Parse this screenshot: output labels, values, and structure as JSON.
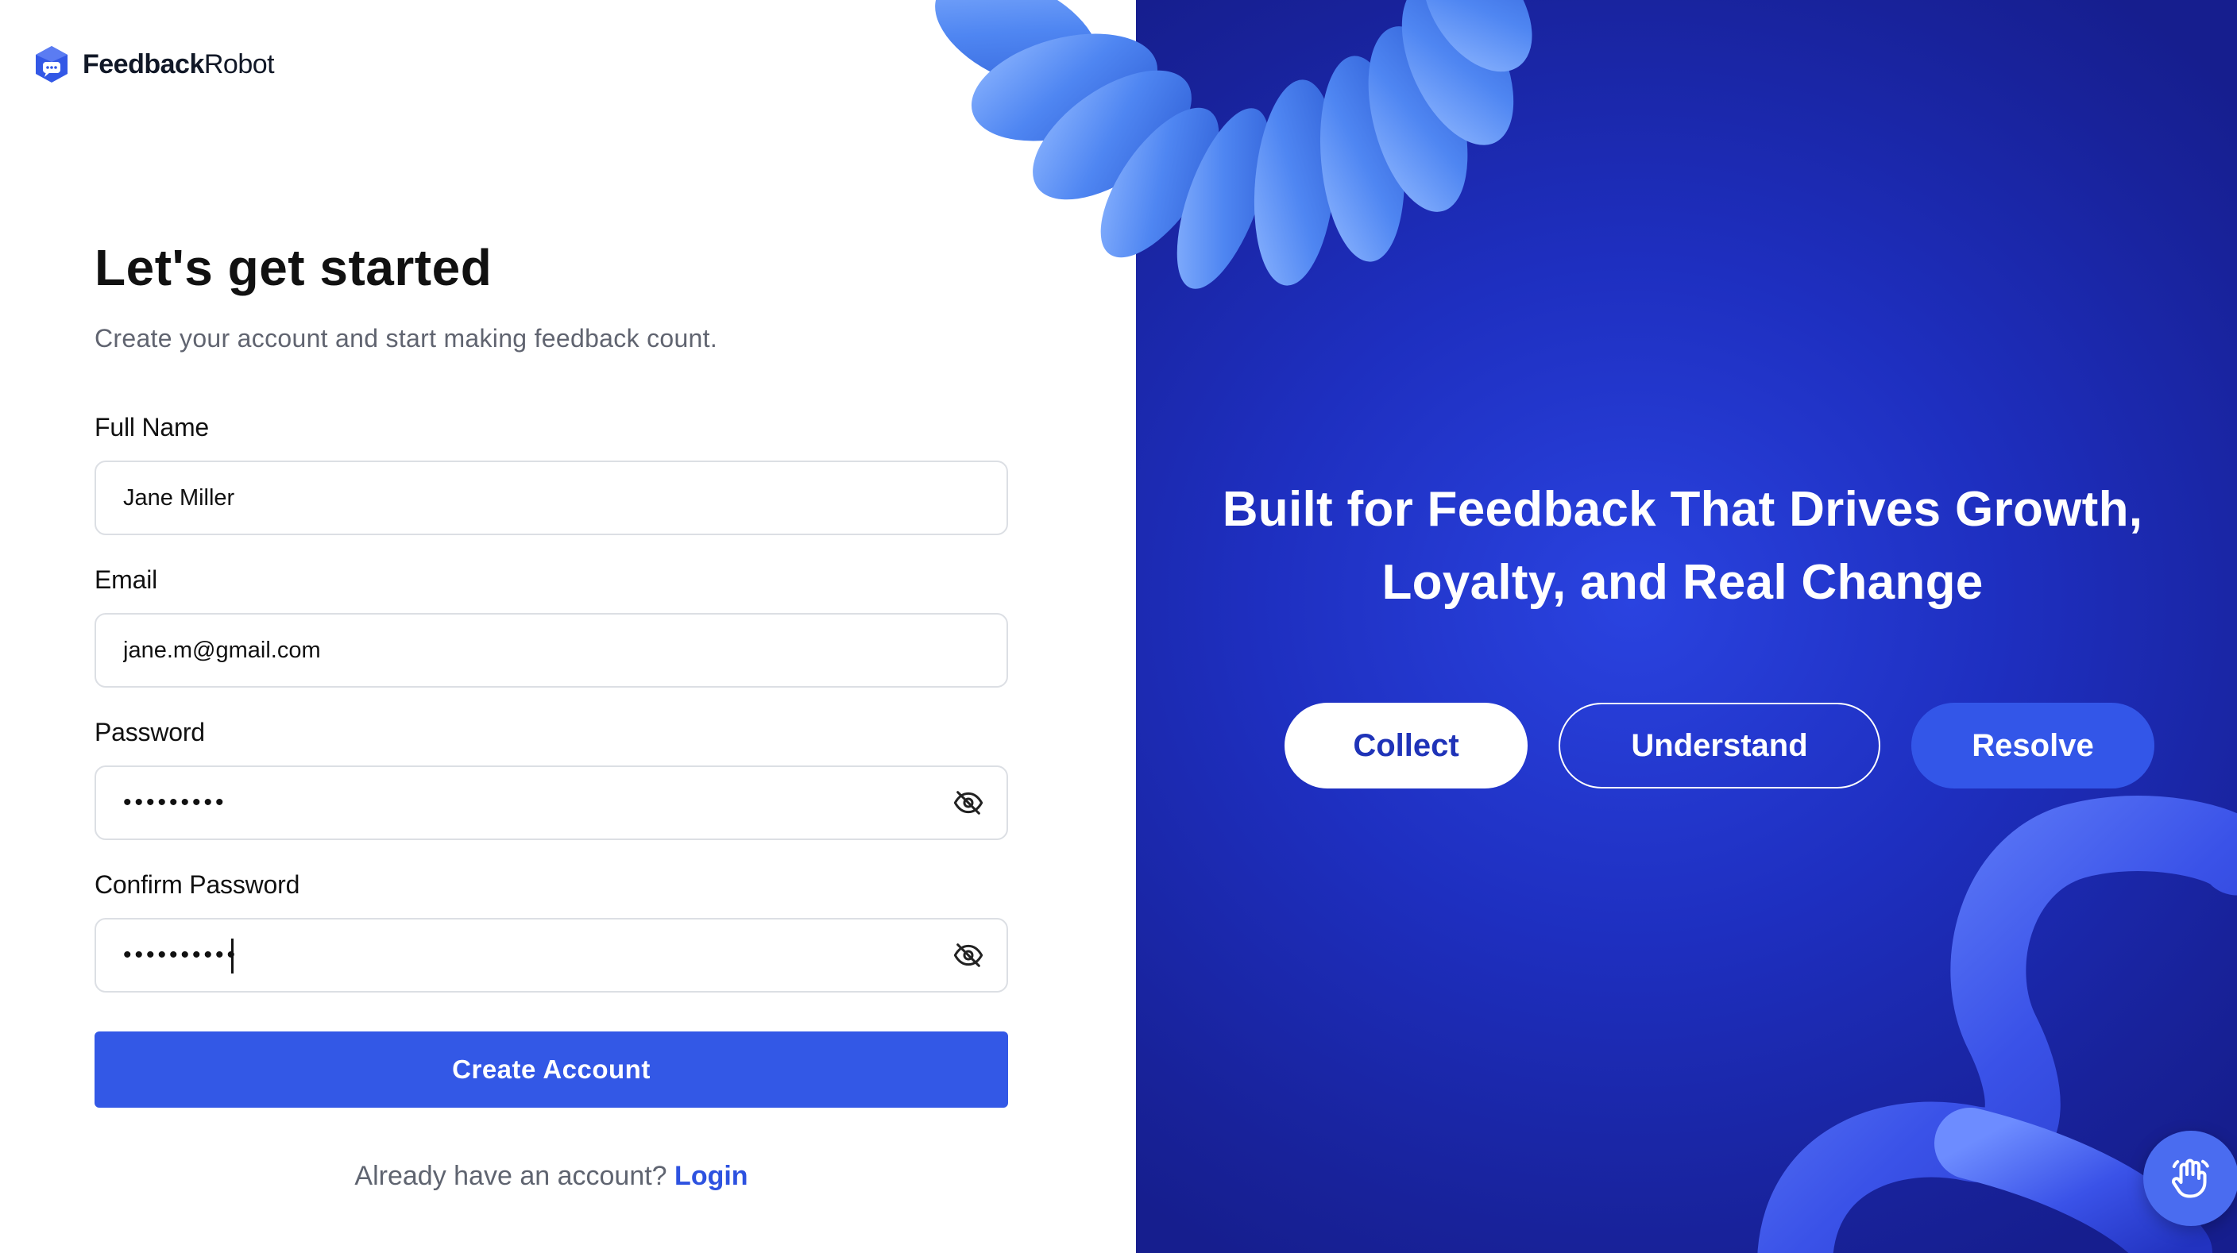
{
  "brand": {
    "name_bold": "Feedback",
    "name_light": "Robot",
    "accent_color": "#3358e6"
  },
  "form": {
    "title": "Let's get started",
    "subtitle": "Create your account and start making feedback count.",
    "full_name": {
      "label": "Full Name",
      "value": "Jane Miller"
    },
    "email": {
      "label": "Email",
      "value": "jane.m@gmail.com"
    },
    "password": {
      "label": "Password",
      "value": "•••••••••",
      "toggle_icon": "eye-off-icon"
    },
    "confirm_password": {
      "label": "Confirm Password",
      "value": "••••••••••",
      "toggle_icon": "eye-off-icon"
    },
    "submit_label": "Create Account",
    "login_prompt": "Already have an account?",
    "login_link": "Login"
  },
  "hero": {
    "headline_line1": "Built for Feedback That Drives Growth,",
    "headline_line2": "Loyalty, and Real Change",
    "pills": [
      {
        "label": "Collect"
      },
      {
        "label": "Understand"
      },
      {
        "label": "Resolve"
      }
    ],
    "background_color": "#1e2fc0"
  },
  "chat_widget": {
    "icon": "waving-hand-icon"
  }
}
